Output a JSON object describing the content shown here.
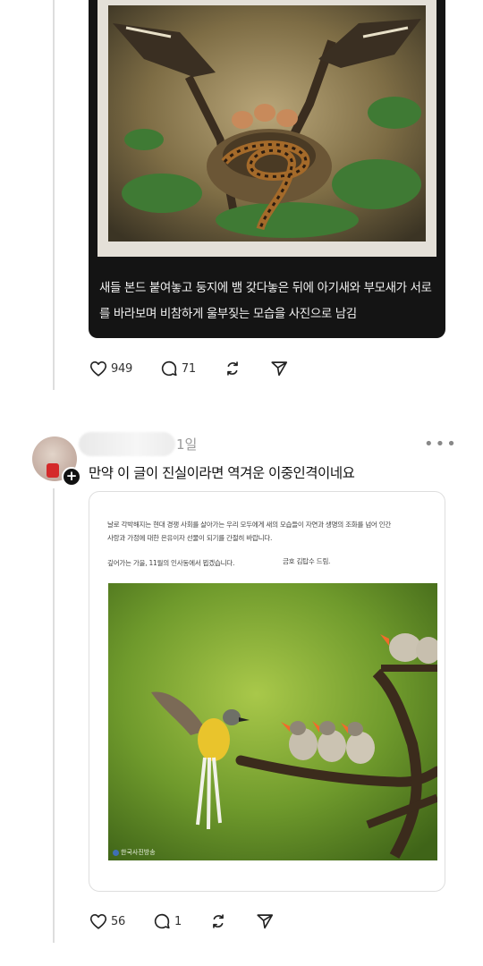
{
  "thread": {
    "first_post": {
      "caption": "새들 본드 붙여놓고 둥지에 뱀 갖다놓은 뒤에 아기새와 부모새가 서로를 바라보며 비참하게 울부짖는 모습을 사진으로 남김",
      "image_icon": "snake-nest-photo",
      "actions": {
        "likes": "949",
        "replies": "71",
        "repost_icon": "repost-icon",
        "share_icon": "send-icon"
      }
    },
    "reply": {
      "time": "1일",
      "more": "•••",
      "follow_badge": "+",
      "text": "만약 이 글이 진실이라면 역겨운 이중인격이네요",
      "embed": {
        "line1": "날로 각박해지는 현대 경쟁 사회를 살아가는 우리 모두에게 새의 모습들이 자연과 생명의 조화를 넘어 인간",
        "line2": "사랑과 가정에 대한 은유이자 선물이 되기를 간절히 바랍니다.",
        "line3": "깊어가는 가을, 11월의 인사동에서 뵙겠습니다.",
        "signature": "금호 김탑수 드림.",
        "watermark": "한국사진방송",
        "image_icon": "bird-feeding-photo"
      },
      "actions": {
        "likes": "56",
        "replies": "1",
        "repost_icon": "repost-icon",
        "share_icon": "send-icon"
      }
    }
  },
  "colors": {
    "caption_bg": "#141414",
    "badge": "#111111",
    "border": "#dedede"
  }
}
